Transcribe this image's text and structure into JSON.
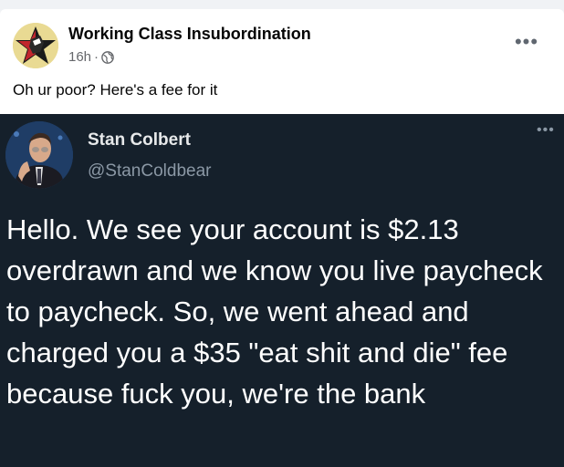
{
  "post": {
    "author": "Working Class Insubordination",
    "time": "16h",
    "separator": "·",
    "caption": "Oh ur poor? Here's a fee for it",
    "more_icon": "more-horizontal-icon",
    "audience_icon": "globe-icon"
  },
  "tweet": {
    "name": "Stan Colbert",
    "handle": "@StanColdbear",
    "text": "Hello. We see your account is $2.13 overdrawn and we know you live paycheck to paycheck. So, we went ahead and charged you a $35 \"eat shit and die\" fee because fuck you, we're the bank",
    "background": "#15202b"
  }
}
